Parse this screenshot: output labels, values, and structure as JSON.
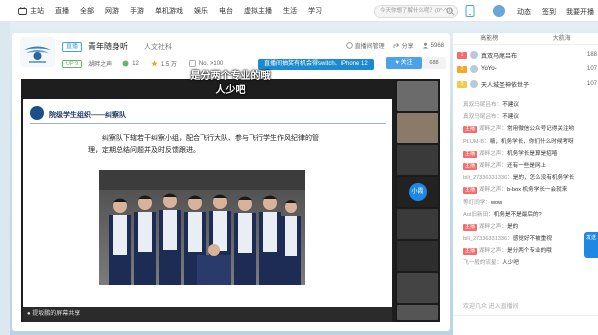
{
  "topnav": {
    "home": "主站",
    "items": [
      "直播",
      "全部",
      "网游",
      "手游",
      "单机游戏",
      "娱乐",
      "电台",
      "虚拟主播",
      "生活",
      "学习"
    ],
    "search_placeholder": "今天你想了解什么呢？(0^-^0)",
    "right": [
      "动态",
      "签到",
      "我要开播"
    ]
  },
  "room": {
    "category_tag": "直播",
    "title": "青年随身听",
    "sub_category": "人文社科",
    "level": "UP 9",
    "streamer": "湖畔之声",
    "likes": "12",
    "popularity": "1.5 万",
    "rank": "No. >100",
    "marquee": "直播间抽奖有机会得switch、iPhone 12",
    "follow": "关注",
    "fans": "688",
    "report": "直播间管理",
    "share": "分享",
    "viewers": "5968"
  },
  "video": {
    "subtitle_1": "是分两个专业的哦",
    "subtitle_2": "人少吧",
    "slide_title": "院级学生组织——纠察队",
    "slide_text": "纠察队下辖若干纠察小组，配合飞行大队、参与飞行学生作风纪律的管理，定期总结问题并及时反馈跟进。",
    "share_notice": "● 提坂鹏的屏幕共享",
    "thumb_names": [
      "",
      "",
      "",
      "小霞",
      "",
      "",
      "",
      "",
      "",
      ""
    ]
  },
  "panel": {
    "tabs": [
      "高能榜",
      "大航海"
    ],
    "rank": [
      {
        "n": "1",
        "name": "真双马尾吕布",
        "val": "188"
      },
      {
        "n": "2",
        "name": "YoYo-",
        "val": "107"
      },
      {
        "n": "3",
        "name": "天人城圣神依世子",
        "val": "107"
      }
    ],
    "messages": [
      {
        "tag": "",
        "name": "真双马尾吕布：",
        "txt": "不建议"
      },
      {
        "tag": "",
        "name": "真双马尾吕布：",
        "txt": "不建议"
      },
      {
        "tag": "主播",
        "name": "湖畔之声：",
        "txt": "常用微信公众号记得关注哟"
      },
      {
        "tag": "",
        "name": "PLUM-B：",
        "txt": "啵，机务学长，你们什么时候考呀"
      },
      {
        "tag": "主播",
        "name": "湖畔之声：",
        "txt": "机务学长是算是招嘻"
      },
      {
        "tag": "主播",
        "name": "湖畔之声：",
        "txt": "还有一些是网上"
      },
      {
        "tag": "",
        "name": "bili_27336331336：",
        "txt": "是的，怎么没有机务学长"
      },
      {
        "tag": "主播",
        "name": "湖畔之声：",
        "txt": "b-box 机务学长一会就来"
      },
      {
        "tag": "",
        "name": "等灯同学：",
        "txt": "wow"
      },
      {
        "tag": "",
        "name": "Aut旧新田：",
        "txt": "机务是不是最后的?"
      },
      {
        "tag": "主播",
        "name": "湖畔之声：",
        "txt": "是的"
      },
      {
        "tag": "",
        "name": "bili_27336331336：",
        "txt": "感觉好不被重视"
      },
      {
        "tag": "主播",
        "name": "湖畔之声：",
        "txt": "是分两个专业的哦"
      },
      {
        "tag": "",
        "name": "飞一般的流星：",
        "txt": "人少吧"
      }
    ],
    "footer": "欢迎几众 进入直播间"
  },
  "side": {
    "btn": "发送"
  }
}
